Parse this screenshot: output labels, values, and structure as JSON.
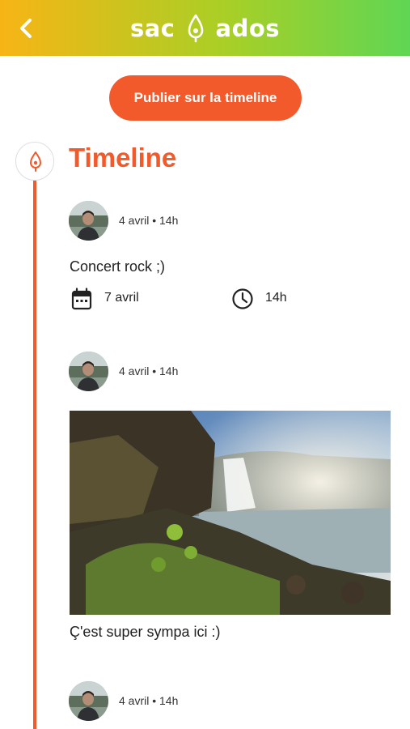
{
  "header": {
    "logo_left": "sac",
    "logo_right": "ados",
    "back_icon": "chevron-left-icon",
    "gradient": [
      "#f7b515",
      "#5fd654"
    ]
  },
  "publish_button": "Publier sur la timeline",
  "timeline": {
    "title": "Timeline",
    "accent": "#f25a2c"
  },
  "posts": [
    {
      "meta": "4 avril • 14h",
      "text": "Concert rock ;)",
      "event": {
        "date": "7 avril",
        "time": "14h"
      }
    },
    {
      "meta": "4 avril • 14h",
      "caption": "Ç'est super sympa ici :)"
    },
    {
      "meta": "4 avril • 14h"
    }
  ]
}
